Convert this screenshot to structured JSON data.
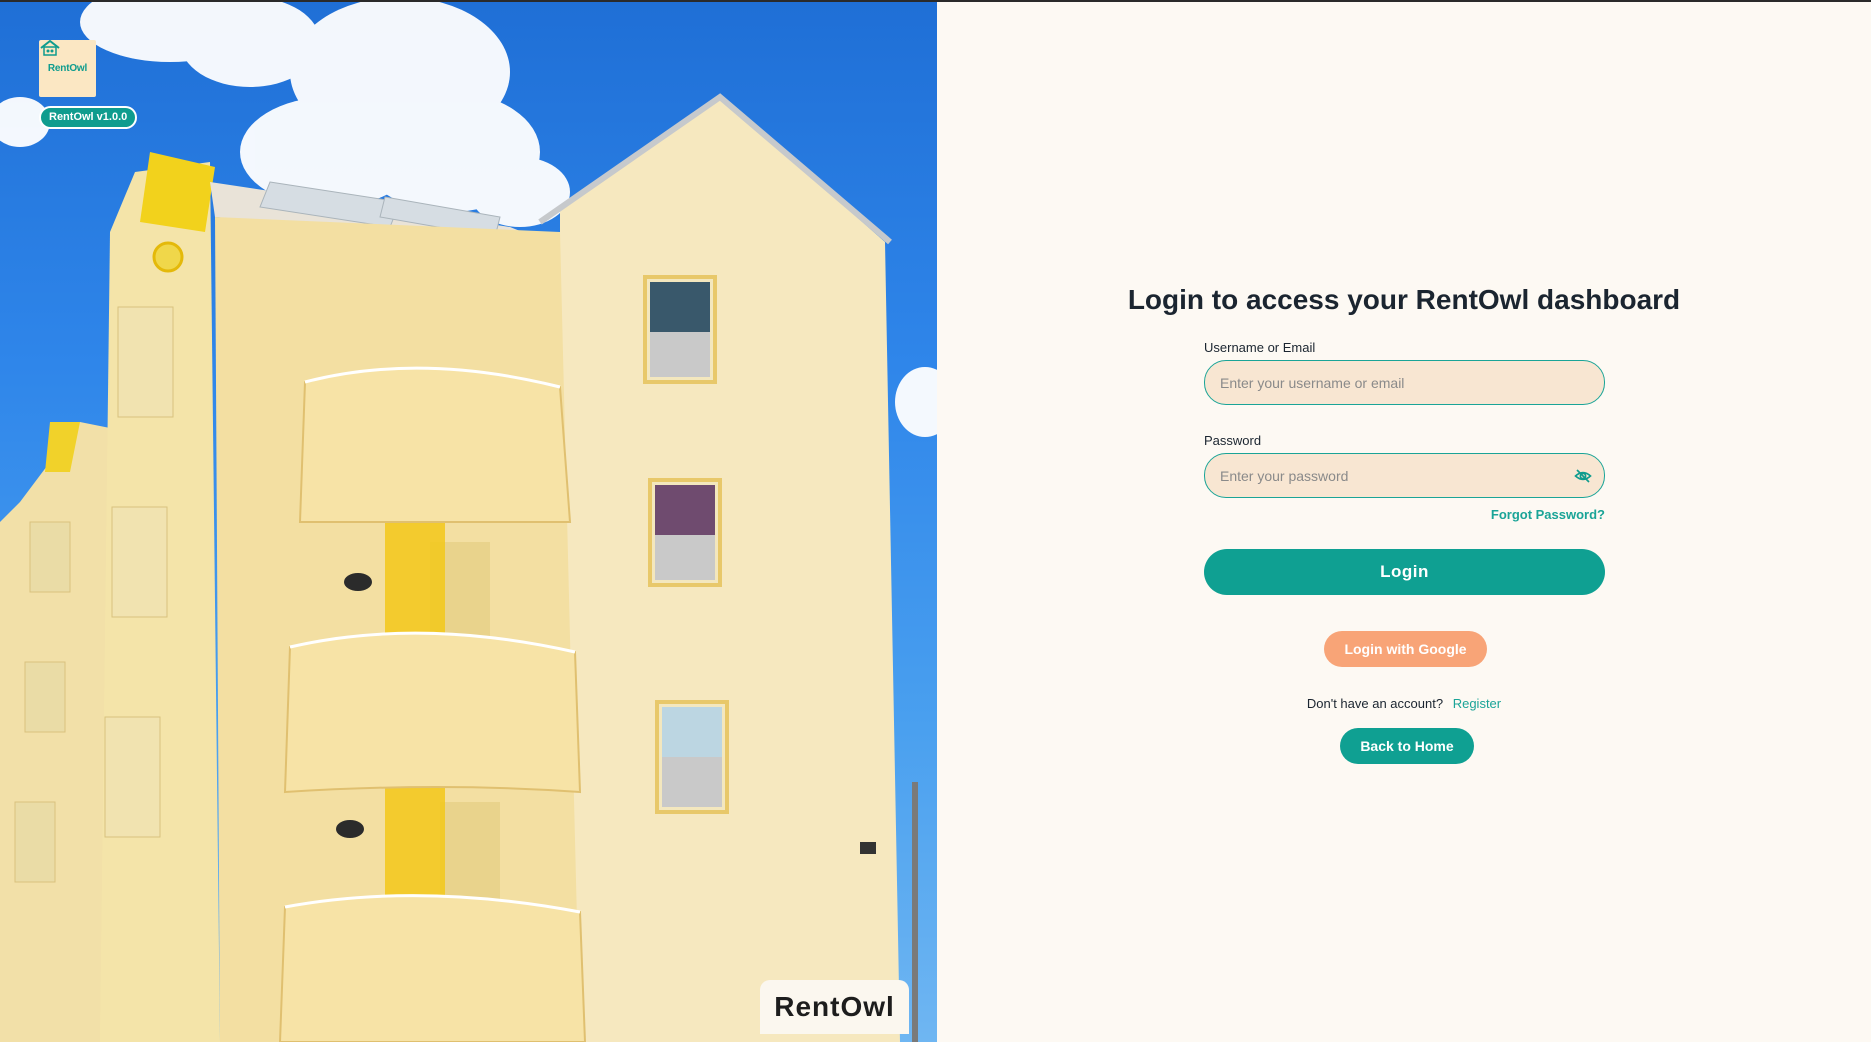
{
  "branding": {
    "logo_text": "RentOwl",
    "version": "RentOwl v1.0.0",
    "photo_tag": "RentOwl"
  },
  "login": {
    "title": "Login to access your RentOwl dashboard",
    "username_label": "Username or Email",
    "username_placeholder": "Enter your username or email",
    "password_label": "Password",
    "password_placeholder": "Enter your password",
    "forgot_password": "Forgot Password?",
    "login_button": "Login",
    "google_button": "Login with Google",
    "no_account_text": "Don't have an account?",
    "register_link": "Register",
    "back_home_button": "Back to Home"
  },
  "icons": {
    "password_toggle": "eye-off-icon",
    "logo": "owl-house-icon"
  },
  "colors": {
    "primary_teal": "#0fa092",
    "google_orange": "#f8a477",
    "input_bg": "#f8e6d2",
    "panel_bg": "#fdf9f3"
  }
}
